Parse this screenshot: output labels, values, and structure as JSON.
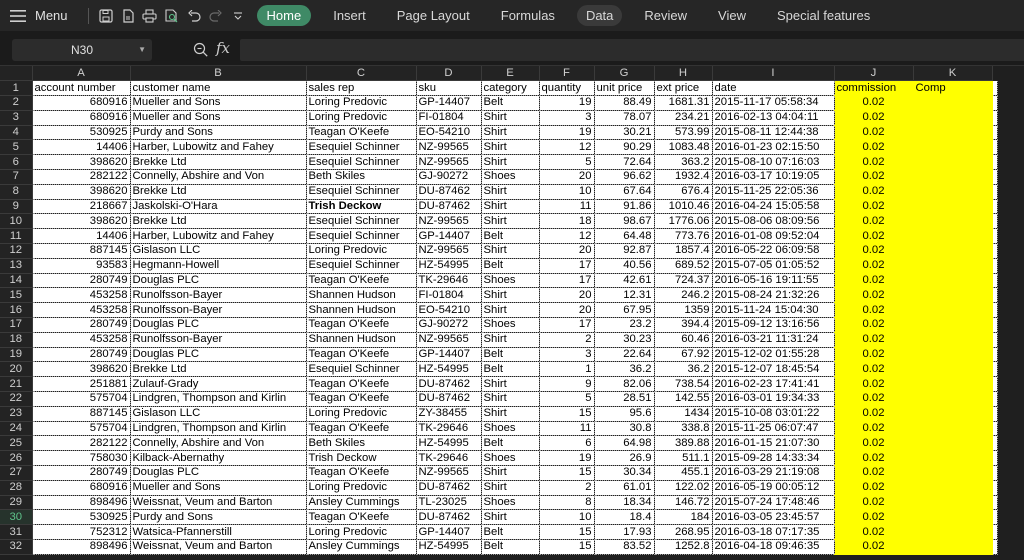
{
  "toolbar": {
    "menu_label": "Menu",
    "tabs": [
      "Home",
      "Insert",
      "Page Layout",
      "Formulas",
      "Data",
      "Review",
      "View",
      "Special features"
    ],
    "active_tab": "Home",
    "hover_tab": "Data"
  },
  "formula_bar": {
    "cell_ref": "N30",
    "fx_label": "fx",
    "formula": ""
  },
  "colors": {
    "accent": "#3f8a66",
    "highlight": "#ffff00"
  },
  "sheet": {
    "column_letters": [
      "A",
      "B",
      "C",
      "D",
      "E",
      "F",
      "G",
      "H",
      "I",
      "J",
      "K"
    ],
    "header_row": [
      "account number",
      "customer name",
      "sales rep",
      "sku",
      "category",
      "quantity",
      "unit price",
      "ext price",
      "date",
      "commission",
      "Comp"
    ],
    "rows": [
      [
        "680916",
        "Mueller and Sons",
        "Loring Predovic",
        "GP-14407",
        "Belt",
        "19",
        "88.49",
        "1681.31",
        "2015-11-17 05:58:34",
        "0.02",
        ""
      ],
      [
        "680916",
        "Mueller and Sons",
        "Loring Predovic",
        "FI-01804",
        "Shirt",
        "3",
        "78.07",
        "234.21",
        "2016-02-13 04:04:11",
        "0.02",
        ""
      ],
      [
        "530925",
        "Purdy and Sons",
        "Teagan O'Keefe",
        "EO-54210",
        "Shirt",
        "19",
        "30.21",
        "573.99",
        "2015-08-11 12:44:38",
        "0.02",
        ""
      ],
      [
        "14406",
        "Harber, Lubowitz and Fahey",
        "Esequiel Schinner",
        "NZ-99565",
        "Shirt",
        "12",
        "90.29",
        "1083.48",
        "2016-01-23 02:15:50",
        "0.02",
        ""
      ],
      [
        "398620",
        "Brekke Ltd",
        "Esequiel Schinner",
        "NZ-99565",
        "Shirt",
        "5",
        "72.64",
        "363.2",
        "2015-08-10 07:16:03",
        "0.02",
        ""
      ],
      [
        "282122",
        "Connelly, Abshire and Von",
        "Beth Skiles",
        "GJ-90272",
        "Shoes",
        "20",
        "96.62",
        "1932.4",
        "2016-03-17 10:19:05",
        "0.02",
        ""
      ],
      [
        "398620",
        "Brekke Ltd",
        "Esequiel Schinner",
        "DU-87462",
        "Shirt",
        "10",
        "67.64",
        "676.4",
        "2015-11-25 22:05:36",
        "0.02",
        ""
      ],
      [
        "218667",
        "Jaskolski-O'Hara",
        "Trish Deckow",
        "DU-87462",
        "Shirt",
        "11",
        "91.86",
        "1010.46",
        "2016-04-24 15:05:58",
        "0.02",
        ""
      ],
      [
        "398620",
        "Brekke Ltd",
        "Esequiel Schinner",
        "NZ-99565",
        "Shirt",
        "18",
        "98.67",
        "1776.06",
        "2015-08-06 08:09:56",
        "0.02",
        ""
      ],
      [
        "14406",
        "Harber, Lubowitz and Fahey",
        "Esequiel Schinner",
        "GP-14407",
        "Belt",
        "12",
        "64.48",
        "773.76",
        "2016-01-08 09:52:04",
        "0.02",
        ""
      ],
      [
        "887145",
        "Gislason LLC",
        "Loring Predovic",
        "NZ-99565",
        "Shirt",
        "20",
        "92.87",
        "1857.4",
        "2016-05-22 06:09:58",
        "0.02",
        ""
      ],
      [
        "93583",
        "Hegmann-Howell",
        "Esequiel Schinner",
        "HZ-54995",
        "Belt",
        "17",
        "40.56",
        "689.52",
        "2015-07-05 01:05:52",
        "0.02",
        ""
      ],
      [
        "280749",
        "Douglas PLC",
        "Teagan O'Keefe",
        "TK-29646",
        "Shoes",
        "17",
        "42.61",
        "724.37",
        "2016-05-16 19:11:55",
        "0.02",
        ""
      ],
      [
        "453258",
        "Runolfsson-Bayer",
        "Shannen Hudson",
        "FI-01804",
        "Shirt",
        "20",
        "12.31",
        "246.2",
        "2015-08-24 21:32:26",
        "0.02",
        ""
      ],
      [
        "453258",
        "Runolfsson-Bayer",
        "Shannen Hudson",
        "EO-54210",
        "Shirt",
        "20",
        "67.95",
        "1359",
        "2015-11-24 15:04:30",
        "0.02",
        ""
      ],
      [
        "280749",
        "Douglas PLC",
        "Teagan O'Keefe",
        "GJ-90272",
        "Shoes",
        "17",
        "23.2",
        "394.4",
        "2015-09-12 13:16:56",
        "0.02",
        ""
      ],
      [
        "453258",
        "Runolfsson-Bayer",
        "Shannen Hudson",
        "NZ-99565",
        "Shirt",
        "2",
        "30.23",
        "60.46",
        "2016-03-21 11:31:24",
        "0.02",
        ""
      ],
      [
        "280749",
        "Douglas PLC",
        "Teagan O'Keefe",
        "GP-14407",
        "Belt",
        "3",
        "22.64",
        "67.92",
        "2015-12-02 01:55:28",
        "0.02",
        ""
      ],
      [
        "398620",
        "Brekke Ltd",
        "Esequiel Schinner",
        "HZ-54995",
        "Belt",
        "1",
        "36.2",
        "36.2",
        "2015-12-07 18:45:54",
        "0.02",
        ""
      ],
      [
        "251881",
        "Zulauf-Grady",
        "Teagan O'Keefe",
        "DU-87462",
        "Shirt",
        "9",
        "82.06",
        "738.54",
        "2016-02-23 17:41:41",
        "0.02",
        ""
      ],
      [
        "575704",
        "Lindgren, Thompson and Kirlin",
        "Teagan O'Keefe",
        "DU-87462",
        "Shirt",
        "5",
        "28.51",
        "142.55",
        "2016-03-01 19:34:33",
        "0.02",
        ""
      ],
      [
        "887145",
        "Gislason LLC",
        "Loring Predovic",
        "ZY-38455",
        "Shirt",
        "15",
        "95.6",
        "1434",
        "2015-10-08 03:01:22",
        "0.02",
        ""
      ],
      [
        "575704",
        "Lindgren, Thompson and Kirlin",
        "Teagan O'Keefe",
        "TK-29646",
        "Shoes",
        "11",
        "30.8",
        "338.8",
        "2015-11-25 06:07:47",
        "0.02",
        ""
      ],
      [
        "282122",
        "Connelly, Abshire and Von",
        "Beth Skiles",
        "HZ-54995",
        "Belt",
        "6",
        "64.98",
        "389.88",
        "2016-01-15 21:07:30",
        "0.02",
        ""
      ],
      [
        "758030",
        "Kilback-Abernathy",
        "Trish Deckow",
        "TK-29646",
        "Shoes",
        "19",
        "26.9",
        "511.1",
        "2015-09-28 14:33:34",
        "0.02",
        ""
      ],
      [
        "280749",
        "Douglas PLC",
        "Teagan O'Keefe",
        "NZ-99565",
        "Shirt",
        "15",
        "30.34",
        "455.1",
        "2016-03-29 21:19:08",
        "0.02",
        ""
      ],
      [
        "680916",
        "Mueller and Sons",
        "Loring Predovic",
        "DU-87462",
        "Shirt",
        "2",
        "61.01",
        "122.02",
        "2016-05-19 00:05:12",
        "0.02",
        ""
      ],
      [
        "898496",
        "Weissnat, Veum and Barton",
        "Ansley Cummings",
        "TL-23025",
        "Shoes",
        "8",
        "18.34",
        "146.72",
        "2015-07-24 17:48:46",
        "0.02",
        ""
      ],
      [
        "530925",
        "Purdy and Sons",
        "Teagan O'Keefe",
        "DU-87462",
        "Shirt",
        "10",
        "18.4",
        "184",
        "2016-03-05 23:45:57",
        "0.02",
        ""
      ],
      [
        "752312",
        "Watsica-Pfannerstill",
        "Loring Predovic",
        "GP-14407",
        "Belt",
        "15",
        "17.93",
        "268.95",
        "2016-03-18 07:17:35",
        "0.02",
        ""
      ],
      [
        "898496",
        "Weissnat, Veum and Barton",
        "Ansley Cummings",
        "HZ-54995",
        "Belt",
        "15",
        "83.52",
        "1252.8",
        "2016-04-18 09:46:35",
        "0.02",
        ""
      ]
    ],
    "bold_cell": {
      "row": 8,
      "col": 2
    },
    "selected_row": 30
  }
}
